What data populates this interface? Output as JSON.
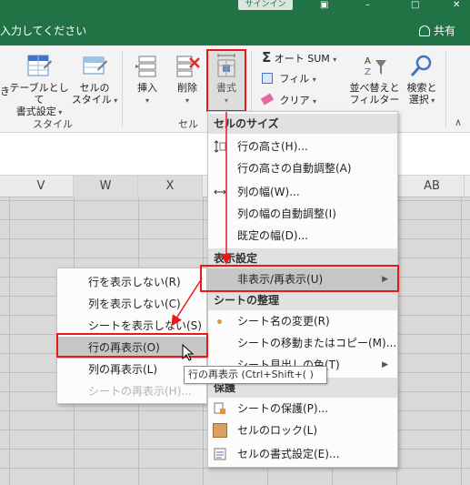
{
  "window": {
    "signin_label": "サインイン"
  },
  "tellbar": {
    "tell_me_text": "入力してください",
    "share_label": "共有"
  },
  "ribbon": {
    "style_group": {
      "partial_label": "き",
      "table_format_label_1": "テーブルとして",
      "table_format_label_2": "書式設定",
      "cell_style_label_1": "セルの",
      "cell_style_label_2": "スタイル",
      "group_label": "スタイル"
    },
    "cells_group": {
      "insert_label": "挿入",
      "delete_label": "削除",
      "format_label": "書式",
      "group_label": "セル"
    },
    "editing_group": {
      "autosum_label": "オート SUM",
      "fill_label": "フィル",
      "clear_label": "クリア",
      "sort_filter_label_1": "並べ替えと",
      "sort_filter_label_2": "フィルター",
      "find_select_label_1": "検索と",
      "find_select_label_2": "選択"
    }
  },
  "columns": [
    "V",
    "W",
    "X",
    "AB"
  ],
  "format_menu": {
    "section_cell_size": "セルのサイズ",
    "row_height": "行の高さ(H)...",
    "autofit_row_height": "行の高さの自動調整(A)",
    "column_width": "列の幅(W)...",
    "autofit_column_width": "列の幅の自動調整(I)",
    "default_width": "既定の幅(D)...",
    "section_visibility": "表示設定",
    "hide_unhide": "非表示/再表示(U)",
    "section_organize_sheets": "シートの整理",
    "rename_sheet": "シート名の変更(R)",
    "move_copy_sheet": "シートの移動またはコピー(M)...",
    "tab_color_partial": "シート見出しの色(T)",
    "section_protection": "保護",
    "protect_sheet": "シートの保護(P)...",
    "lock_cell": "セルのロック(L)",
    "format_cells": "セルの書式設定(E)..."
  },
  "submenu": {
    "hide_rows": "行を表示しない(R)",
    "hide_columns": "列を表示しない(C)",
    "hide_sheet": "シートを表示しない(S)",
    "unhide_rows": "行の再表示(O)",
    "unhide_columns": "列の再表示(L)",
    "unhide_sheet": "シートの再表示(H)..."
  },
  "tooltip": {
    "text": "行の再表示 (Ctrl+Shift+( )"
  },
  "colors": {
    "excel_green": "#217346",
    "highlight_red": "#e81919",
    "menu_highlight": "#c6c6c6"
  }
}
